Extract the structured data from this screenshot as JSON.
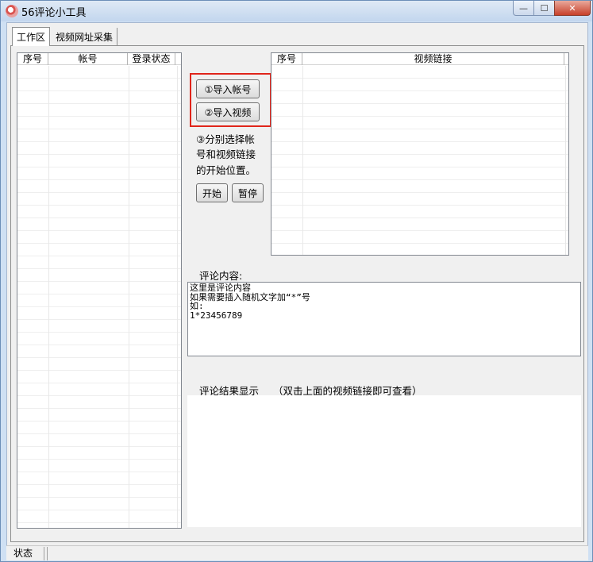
{
  "window": {
    "title": "56评论小工具",
    "min_glyph": "—",
    "max_glyph": "☐",
    "close_glyph": "✕"
  },
  "tabs": [
    {
      "label": "工作区",
      "active": true
    },
    {
      "label": "视频网址采集",
      "active": false
    }
  ],
  "accounts_list": {
    "columns": [
      "序号",
      "帐号",
      "登录状态"
    ],
    "rows": []
  },
  "video_list": {
    "columns": [
      "序号",
      "视频链接"
    ],
    "rows": []
  },
  "buttons": {
    "import_accounts": "①导入帐号",
    "import_videos": "②导入视频",
    "start": "开始",
    "pause": "暂停"
  },
  "instructions": {
    "line1": "③分别选择帐",
    "line2": "号和视频链接",
    "line3": "的开始位置。"
  },
  "comment": {
    "label": "评论内容:",
    "value": "这里是评论内容\n如果需要插入随机文字加“*”号\n如:\n1*23456789"
  },
  "results": {
    "label": "评论结果显示",
    "hint": "（双击上面的视频链接即可查看）"
  },
  "status": {
    "label": "状态"
  },
  "colors": {
    "highlight": "#e0251b",
    "titlebar": "#c2d6ee"
  }
}
